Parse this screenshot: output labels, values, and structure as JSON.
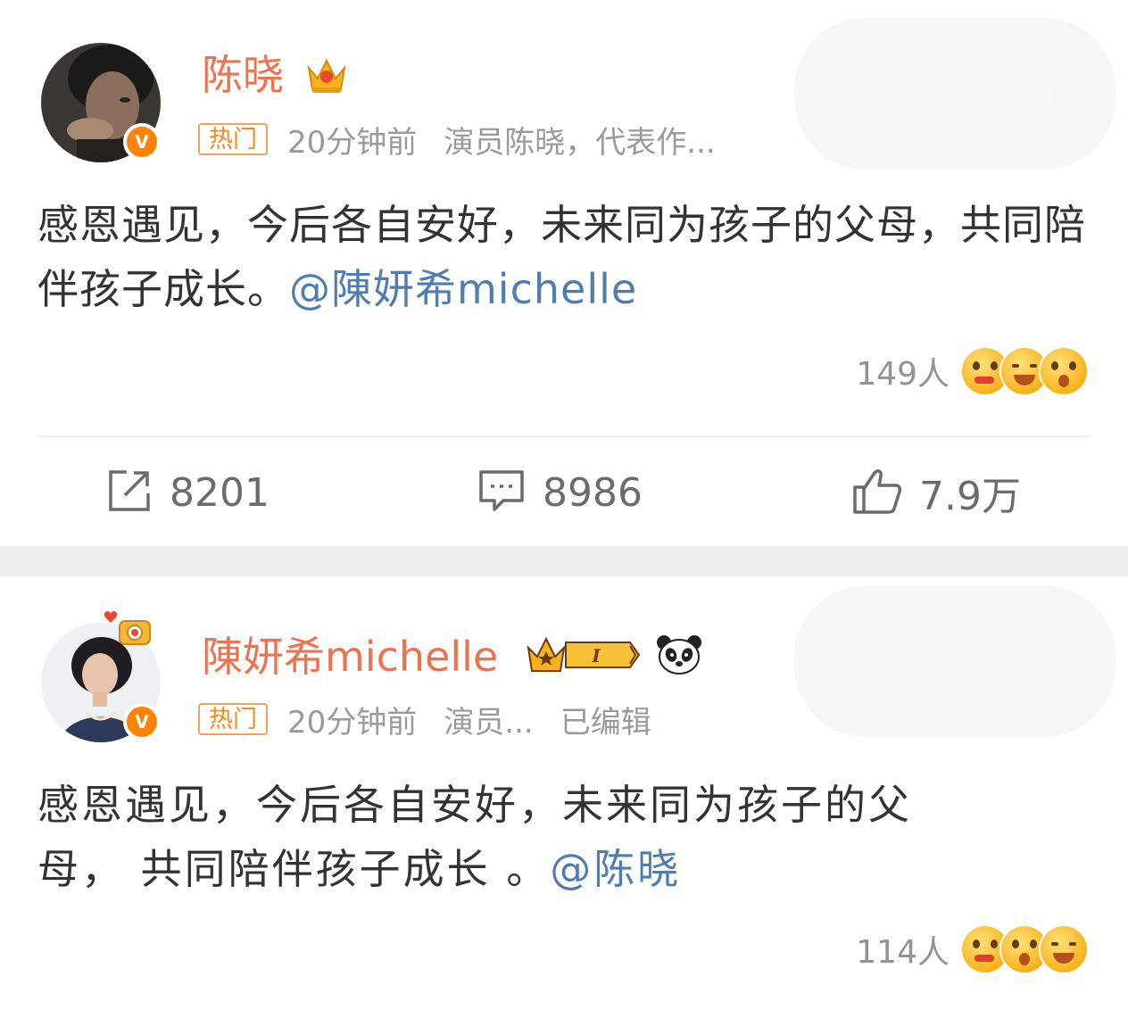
{
  "posts": [
    {
      "username": "陈晓",
      "hot_tag": "热门",
      "time": "20分钟前",
      "source": "演员陈晓，代表作...",
      "edited": "",
      "text": "感恩遇见，今后各自安好，未来同为孩子的父母，共同陪伴孩子成长。",
      "mention": "@陳妍希michelle",
      "reaction_count": "149人",
      "actions": {
        "repost": "8201",
        "comment": "8986",
        "like": "7.9万"
      }
    },
    {
      "username": "陳妍希michelle",
      "level_badge": "I",
      "hot_tag": "热门",
      "time": "20分钟前",
      "source": "演员...",
      "edited": "已编辑",
      "text_line1": "感恩遇见，今后各自安好，未来同为孩子的父",
      "text_line2": "母， 共同陪伴孩子成长 。",
      "mention": "@陈晓",
      "reaction_count": "114人"
    }
  ],
  "colors": {
    "username": "#eb7350",
    "mention": "#507daf",
    "verified": "#ff8200",
    "hot_tag": "#f08a24"
  },
  "icons": {
    "verified": "v-badge-icon",
    "repost": "repost-icon",
    "comment": "comment-icon",
    "like": "thumbs-up-icon"
  }
}
